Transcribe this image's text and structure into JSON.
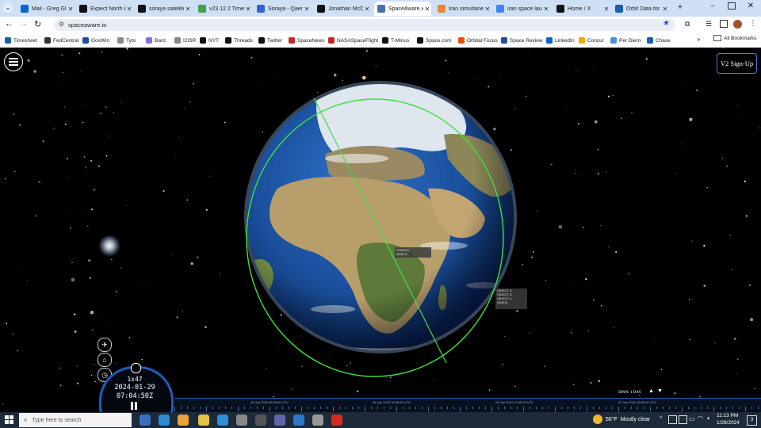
{
  "tabs": [
    {
      "title": "Mail - Greg Gl",
      "color": "#0a64c8"
    },
    {
      "title": "Expect North K",
      "color": "#111111"
    },
    {
      "title": "soraya satellite",
      "color": "#111111"
    },
    {
      "title": "v23.12.2 Time",
      "color": "#3fa34d"
    },
    {
      "title": "Soraya - Qaem",
      "color": "#3366cc"
    },
    {
      "title": "Jonathan McD",
      "color": "#111111"
    },
    {
      "title": "SpaceAware.io",
      "color": "#4a6fa5"
    },
    {
      "title": "Iran simultane",
      "color": "#e08a3c"
    },
    {
      "title": "iran space laun",
      "color": "#4285f4"
    },
    {
      "title": "Home / X",
      "color": "#111111"
    },
    {
      "title": "Orbit Data for",
      "color": "#1a5fa8"
    }
  ],
  "active_tab_index": 6,
  "address_bar": {
    "url": "spaceaware.io"
  },
  "bookmarks": [
    {
      "label": "Timesheet",
      "color": "#1a5fa8"
    },
    {
      "label": "FedCentral",
      "color": "#333333"
    },
    {
      "label": "GovWin",
      "color": "#1f4e9c"
    },
    {
      "label": "Tyto",
      "color": "#888888"
    },
    {
      "label": "Bard",
      "color": "#8a6be0"
    },
    {
      "label": "I2ISR",
      "color": "#888888"
    },
    {
      "label": "NYT",
      "color": "#111111"
    },
    {
      "label": "Threads",
      "color": "#111111"
    },
    {
      "label": "Twitter",
      "color": "#111111"
    },
    {
      "label": "SpaceNews",
      "color": "#c62828"
    },
    {
      "label": "NASASpaceFlight",
      "color": "#c62828"
    },
    {
      "label": "T-Minus",
      "color": "#111111"
    },
    {
      "label": "Space.com",
      "color": "#111111"
    },
    {
      "label": "Orbital Focus",
      "color": "#e65100"
    },
    {
      "label": "Space Review",
      "color": "#1f4e9c"
    },
    {
      "label": "LinkedIn",
      "color": "#0a66c2"
    },
    {
      "label": "Concur",
      "color": "#f2a900"
    },
    {
      "label": "Per Diem",
      "color": "#4a90d9"
    },
    {
      "label": "Chase",
      "color": "#1a5fa8"
    }
  ],
  "all_bookmarks_label": "All Bookmarks",
  "app": {
    "signup_label": "V2 Sign-Up",
    "satellite_label_line1": "SORAYA",
    "satellite_label_line2": "(58817)",
    "objects_line1": "OBJECT C",
    "objects_line2": "OBJECT B",
    "objects_line3": "OBJECT A",
    "objects_line4": "(58818)",
    "speed": "1x47",
    "date": "2024-01-29",
    "time": "07:04:50Z",
    "span_label": "SPAN: 1 DAY",
    "timeline_ticks": [
      "28 Jan 2024 06:00:00 UTC",
      "28 Jan 2024 18:00:00 UTC",
      "29 Jan 2024 12:00:00 UTC",
      "29 Jan 2024 18:00:00 UTC"
    ]
  },
  "taskbar": {
    "search_placeholder": "Type here to search",
    "weather": "56°F  Mostly clear",
    "clock_time": "11:13 PM",
    "clock_date": "1/28/2024",
    "notification_count": "3"
  },
  "colors": {
    "orbit": "#3fe03f",
    "tabstrip": "#cfe0f6",
    "taskbar": "#1d2a3a",
    "timeline": "#2a5ea8",
    "clock_ring": "#1f5fb8"
  }
}
